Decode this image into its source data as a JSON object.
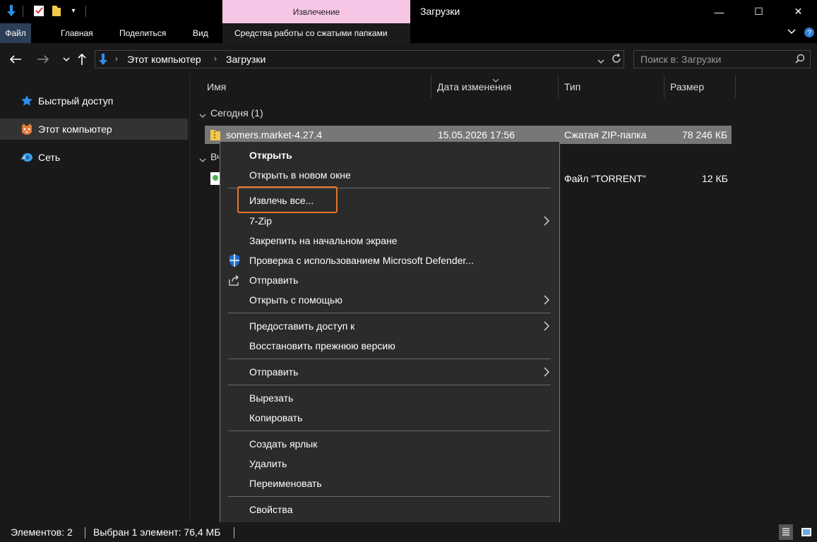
{
  "titlebar": {
    "context_tab_header": "Извлечение",
    "window_title": "Загрузки",
    "minimize": "—",
    "maximize": "☐",
    "close": "✕"
  },
  "ribbon": {
    "tabs": [
      "Файл",
      "Главная",
      "Поделиться",
      "Вид"
    ],
    "context_tab": "Средства работы со сжатыми папками"
  },
  "address": {
    "crumbs": [
      "Этот компьютер",
      "Загрузки"
    ],
    "search_placeholder": "Поиск в: Загрузки"
  },
  "sidebar": {
    "items": [
      {
        "label": "Быстрый доступ",
        "icon": "star-icon"
      },
      {
        "label": "Этот компьютер",
        "icon": "this-pc-icon"
      },
      {
        "label": "Сеть",
        "icon": "network-icon"
      }
    ]
  },
  "columns": [
    "Имя",
    "Дата изменения",
    "Тип",
    "Размер"
  ],
  "groups": [
    {
      "title": "Сегодня (1)",
      "files": [
        {
          "name": "somers.market-4.27.4",
          "date": "15.05.2026 17:56",
          "type": "Сжатая ZIP-папка",
          "size": "78 246 КБ"
        }
      ]
    },
    {
      "title": "Вч",
      "files": [
        {
          "name": "",
          "date": "",
          "type": "Файл \"TORRENT\"",
          "size": "12 КБ"
        }
      ]
    }
  ],
  "context_menu": {
    "items": [
      "Открыть",
      "Открыть в новом окне",
      "Извлечь все...",
      "7-Zip",
      "Закрепить на начальном экране",
      "Проверка с использованием Microsoft Defender...",
      "Отправить",
      "Открыть с помощью",
      "Предоставить доступ к",
      "Восстановить прежнюю версию",
      "Отправить",
      "Вырезать",
      "Копировать",
      "Создать ярлык",
      "Удалить",
      "Переименовать",
      "Свойства"
    ]
  },
  "status": {
    "items_count": "Элементов: 2",
    "selected": "Выбран 1 элемент: 76,4 МБ"
  },
  "colors": {
    "accent_pink": "#f7c6e6",
    "highlight_orange": "#e8742c",
    "selected_row": "#777777"
  }
}
